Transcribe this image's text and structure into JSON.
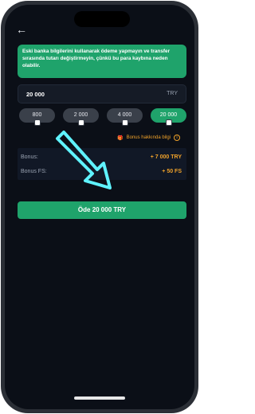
{
  "alert": {
    "text": "Eski banka bilgilerini kullanarak ödeme yapmayın ve transfer sırasında tutarı değiştirmeyin, çünkü bu para kaybına neden olabilir."
  },
  "amount": {
    "value": "20 000",
    "currency": "TRY"
  },
  "presets": [
    {
      "label": "800"
    },
    {
      "label": "2 000"
    },
    {
      "label": "4 000"
    },
    {
      "label": "20 000"
    }
  ],
  "bonus_info": {
    "label": "Bonus hakkında bilgi",
    "icon": "info-icon"
  },
  "bonus": {
    "rows": [
      {
        "label": "Bonus:",
        "value": "+ 7 000 TRY"
      },
      {
        "label": "Bonus FS:",
        "value": "+ 50 FS"
      }
    ]
  },
  "pay_button": {
    "label": "Öde 20 000 TRY"
  },
  "colors": {
    "accent": "#1fa36b",
    "bonus": "#f0a22a",
    "arrow": "#5ff3ff"
  },
  "icons": {
    "back": "arrow-left-icon",
    "gift": "gift-icon",
    "annotation_arrow": "arrow-down-left-icon"
  }
}
